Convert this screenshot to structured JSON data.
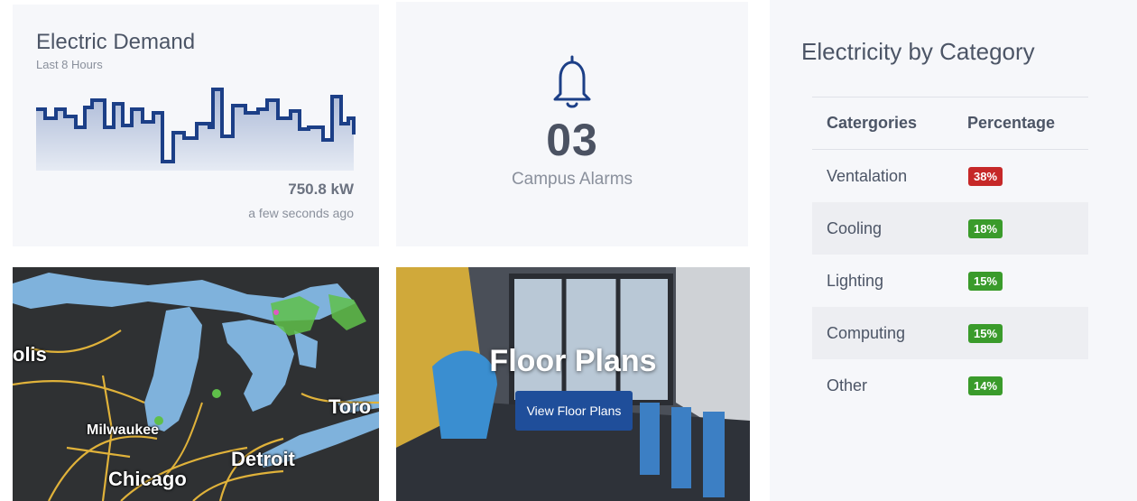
{
  "demand": {
    "title": "Electric Demand",
    "subtitle": "Last 8 Hours",
    "value": "750.8 kW",
    "updated": "a few seconds ago",
    "line_color": "#1c3f87",
    "fill_color": "#cdd6e7"
  },
  "alarms": {
    "count": "03",
    "label": "Campus Alarms",
    "icon": "bell-icon",
    "icon_color": "#1c3f87"
  },
  "categories": {
    "title": "Electricity by Category",
    "headers": [
      "Catergories",
      "Percentage"
    ],
    "rows": [
      {
        "name": "Ventalation",
        "percent": "38%",
        "color": "#c62828"
      },
      {
        "name": "Cooling",
        "percent": "18%",
        "color": "#3a9b2b"
      },
      {
        "name": "Lighting",
        "percent": "15%",
        "color": "#3a9b2b"
      },
      {
        "name": "Computing",
        "percent": "15%",
        "color": "#3a9b2b"
      },
      {
        "name": "Other",
        "percent": "14%",
        "color": "#3a9b2b"
      }
    ]
  },
  "map": {
    "labels": [
      "olis",
      "Toro",
      "Milwaukee",
      "Detroit",
      "Chicago"
    ]
  },
  "floor_plans": {
    "title": "Floor Plans",
    "button": "View Floor Plans"
  }
}
